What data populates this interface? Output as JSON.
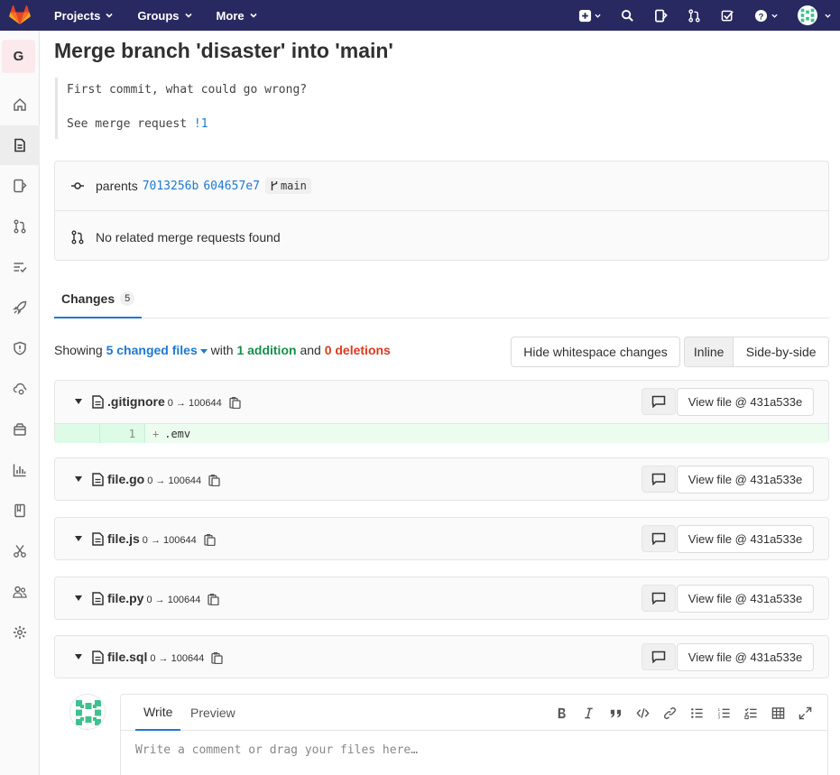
{
  "nav": {
    "projects_label": "Projects",
    "groups_label": "Groups",
    "more_label": "More",
    "background": "#292961"
  },
  "sidebar": {
    "project_initial": "G"
  },
  "commit": {
    "title": "Merge branch 'disaster' into 'main'",
    "description_line1": "First commit, what could go wrong?",
    "description_line2_prefix": "See merge request ",
    "merge_request_ref": "!1",
    "parents_label": "parents",
    "parent1": "7013256b",
    "parent2": "604657e7",
    "branch": "main",
    "related_mrs": "No related merge requests found"
  },
  "changes": {
    "tab_label": "Changes",
    "count": "5",
    "showing_label": "Showing",
    "changed_files": "5 changed files",
    "with_label": "with",
    "additions": "1 addition",
    "and_label": "and",
    "deletions": "0 deletions",
    "hide_whitespace_label": "Hide whitespace changes",
    "inline_label": "Inline",
    "side_by_side_label": "Side-by-side"
  },
  "files": [
    {
      "name": ".gitignore",
      "mode": "0 → 100644",
      "view_label": "View file @ 431a533e"
    },
    {
      "name": "file.go",
      "mode": "0 → 100644",
      "view_label": "View file @ 431a533e"
    },
    {
      "name": "file.js",
      "mode": "0 → 100644",
      "view_label": "View file @ 431a533e"
    },
    {
      "name": "file.py",
      "mode": "0 → 100644",
      "view_label": "View file @ 431a533e"
    },
    {
      "name": "file.sql",
      "mode": "0 → 100644",
      "view_label": "View file @ 431a533e"
    }
  ],
  "diff": {
    "line_number": "1",
    "plus": "+",
    "code": ".emv"
  },
  "comment": {
    "write_label": "Write",
    "preview_label": "Preview",
    "placeholder": "Write a comment or drag your files here…"
  }
}
